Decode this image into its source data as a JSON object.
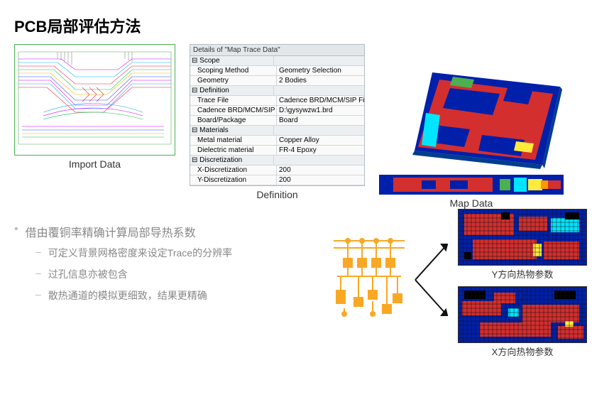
{
  "title": "PCB局部评估方法",
  "captions": {
    "import": "Import Data",
    "definition": "Definition",
    "mapdata": "Map Data",
    "ydir": "Y方向热物参数",
    "xdir": "X方向热物参数"
  },
  "definition_table": {
    "title": "Details of \"Map Trace Data\"",
    "sections": [
      {
        "header": "Scope",
        "rows": [
          [
            "Scoping Method",
            "Geometry Selection"
          ],
          [
            "Geometry",
            "2 Bodies"
          ]
        ]
      },
      {
        "header": "Definition",
        "rows": [
          [
            "Trace File",
            "Cadence BRD/MCM/SIP File"
          ],
          [
            "Cadence BRD/MCM/SIP File",
            "D:\\gysywzw1.brd"
          ],
          [
            "Board/Package",
            "Board"
          ]
        ]
      },
      {
        "header": "Materials",
        "rows": [
          [
            "Metal material",
            "Copper Alloy"
          ],
          [
            "Dielectric material",
            "FR-4 Epoxy"
          ]
        ]
      },
      {
        "header": "Discretization",
        "rows": [
          [
            "X-Discretization",
            "200"
          ],
          [
            "Y-Discretization",
            "200"
          ]
        ]
      }
    ]
  },
  "bullets": {
    "main": "借由覆铜率精确计算局部导热系数",
    "subs": [
      "可定义背景网格密度来设定Trace的分辨率",
      "过孔信息亦被包含",
      "散热通道的模拟更细致，结果更精确"
    ]
  }
}
